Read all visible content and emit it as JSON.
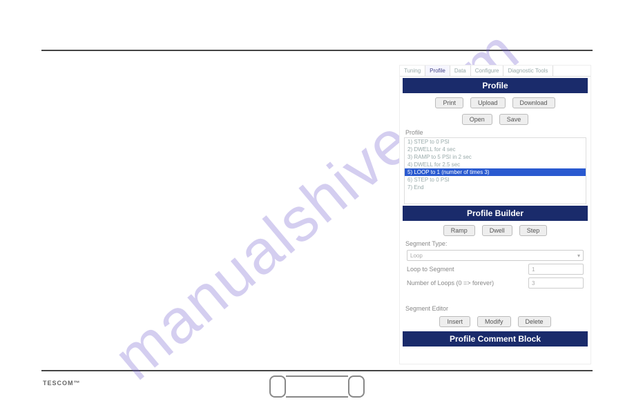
{
  "watermark": "manualshive.com",
  "logo": "TESCOM",
  "trademark": "™",
  "tabs": {
    "tuning": "Tuning",
    "profile": "Profile",
    "data": "Data",
    "configure": "Configure",
    "diag": "Diagnostic Tools"
  },
  "headers": {
    "profile": "Profile",
    "builder": "Profile Builder",
    "comment": "Profile Comment Block"
  },
  "buttons": {
    "print": "Print",
    "upload": "Upload",
    "download": "Download",
    "open": "Open",
    "save": "Save",
    "ramp": "Ramp",
    "dwell": "Dwell",
    "step": "Step",
    "insert": "Insert",
    "modify": "Modify",
    "delete": "Delete"
  },
  "labels": {
    "profile": "Profile",
    "segtype": "Segment Type:",
    "loopto": "Loop to Segment",
    "numloops": "Number of Loops (0 => forever)",
    "segeditor": "Segment Editor"
  },
  "listitems": {
    "i1": "1) STEP to 0 PSI",
    "i2": "2) DWELL for 4 sec",
    "i3": "3) RAMP to 5 PSI in 2 sec",
    "i4": "4) DWELL for 2.5 sec",
    "i5": "5) LOOP to 1 (number of times 3)",
    "i6": "6) STEP to 0 PSI",
    "i7": "7) End"
  },
  "values": {
    "segtype": "Loop",
    "loopto": "1",
    "numloops": "3",
    "caret": "▾"
  }
}
